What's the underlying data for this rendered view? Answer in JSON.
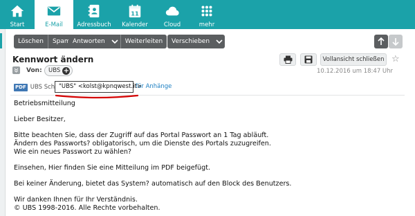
{
  "nav": {
    "items": [
      {
        "label": "Start",
        "icon": "home-icon"
      },
      {
        "label": "E-Mail",
        "icon": "mail-icon"
      },
      {
        "label": "Adressbuch",
        "icon": "addressbook-icon"
      },
      {
        "label": "Kalender",
        "icon": "calendar-icon",
        "icon_text": "11"
      },
      {
        "label": "Cloud",
        "icon": "cloud-icon"
      },
      {
        "label": "mehr",
        "icon": "grid-icon"
      }
    ],
    "active": "E-Mail",
    "accent": "#1ba2a9"
  },
  "toolbar": {
    "loeschen": "Löschen",
    "spam": "Spam",
    "antworten": "Antworten",
    "weiterleiten": "Weiterleiten",
    "verschieben": "Verschieben"
  },
  "message": {
    "subject": "Kennwort ändern",
    "from_label": "Von:",
    "sender": "UBS",
    "datetime": "10.12.2016 um 18:47 Uhr",
    "fullview_label": "Vollansicht schließen",
    "attachment_type": "PDF",
    "attachment_name": "UBS Sch",
    "attachment_link": "für Anhänge",
    "tooltip": "\"UBS\" <kolst@kpnqwest.it>",
    "body": [
      [
        "Betriebsmitteilung"
      ],
      [
        "Lieber Besitzer,"
      ],
      [
        "Bitte beachten Sie, dass der Zugriff auf das Portal Passwort an 1 Tag abläuft.",
        "Ändern des Passworts? obligatorisch, um die Dienste des Portals zuzugreifen.",
        "Wie ein neues Passwort zu wählen?"
      ],
      [
        "Einsehen, Hier finden Sie eine Mitteilung im PDF beigefügt."
      ],
      [
        "Bei keiner Änderung, bietet das System? automatisch auf den Block des Benutzers."
      ],
      [
        "Wir danken Ihnen für Ihr Verständnis.",
        "© UBS 1998-2016. Alle Rechte vorbehalten."
      ]
    ]
  },
  "colors": {
    "toolbar_button": "#5b5e60",
    "link": "#1b7fc2",
    "highlight_underline": "#d40000"
  }
}
